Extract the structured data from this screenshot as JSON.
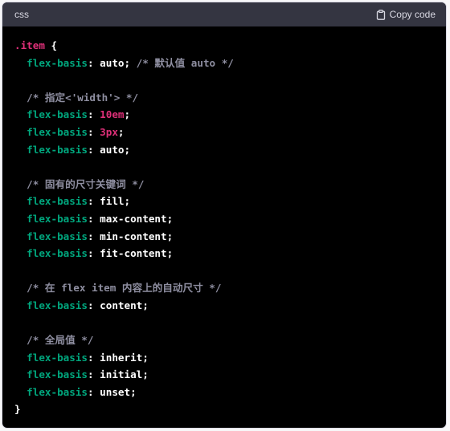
{
  "header": {
    "language": "css",
    "copy_label": "Copy code",
    "copy_icon": "clipboard-icon"
  },
  "code": {
    "lines": [
      [
        {
          "t": ".item",
          "c": "sel"
        },
        {
          "t": " {",
          "c": "punc"
        }
      ],
      [
        {
          "t": "  ",
          "c": "punc"
        },
        {
          "t": "flex-basis",
          "c": "prop"
        },
        {
          "t": ": auto; ",
          "c": "punc"
        },
        {
          "t": "/* 默认值 auto */",
          "c": "cmt"
        }
      ],
      [],
      [
        {
          "t": "  ",
          "c": "punc"
        },
        {
          "t": "/* 指定<'width'> */",
          "c": "cmt"
        }
      ],
      [
        {
          "t": "  ",
          "c": "punc"
        },
        {
          "t": "flex-basis",
          "c": "prop"
        },
        {
          "t": ": ",
          "c": "punc"
        },
        {
          "t": "10em",
          "c": "num"
        },
        {
          "t": ";",
          "c": "punc"
        }
      ],
      [
        {
          "t": "  ",
          "c": "punc"
        },
        {
          "t": "flex-basis",
          "c": "prop"
        },
        {
          "t": ": ",
          "c": "punc"
        },
        {
          "t": "3px",
          "c": "num"
        },
        {
          "t": ";",
          "c": "punc"
        }
      ],
      [
        {
          "t": "  ",
          "c": "punc"
        },
        {
          "t": "flex-basis",
          "c": "prop"
        },
        {
          "t": ": auto;",
          "c": "punc"
        }
      ],
      [],
      [
        {
          "t": "  ",
          "c": "punc"
        },
        {
          "t": "/* 固有的尺寸关键词 */",
          "c": "cmt"
        }
      ],
      [
        {
          "t": "  ",
          "c": "punc"
        },
        {
          "t": "flex-basis",
          "c": "prop"
        },
        {
          "t": ": fill;",
          "c": "punc"
        }
      ],
      [
        {
          "t": "  ",
          "c": "punc"
        },
        {
          "t": "flex-basis",
          "c": "prop"
        },
        {
          "t": ": max-content;",
          "c": "punc"
        }
      ],
      [
        {
          "t": "  ",
          "c": "punc"
        },
        {
          "t": "flex-basis",
          "c": "prop"
        },
        {
          "t": ": min-content;",
          "c": "punc"
        }
      ],
      [
        {
          "t": "  ",
          "c": "punc"
        },
        {
          "t": "flex-basis",
          "c": "prop"
        },
        {
          "t": ": fit-content;",
          "c": "punc"
        }
      ],
      [],
      [
        {
          "t": "  ",
          "c": "punc"
        },
        {
          "t": "/* 在 flex item 内容上的自动尺寸 */",
          "c": "cmt"
        }
      ],
      [
        {
          "t": "  ",
          "c": "punc"
        },
        {
          "t": "flex-basis",
          "c": "prop"
        },
        {
          "t": ": content;",
          "c": "punc"
        }
      ],
      [],
      [
        {
          "t": "  ",
          "c": "punc"
        },
        {
          "t": "/* 全局值 */",
          "c": "cmt"
        }
      ],
      [
        {
          "t": "  ",
          "c": "punc"
        },
        {
          "t": "flex-basis",
          "c": "prop"
        },
        {
          "t": ": inherit;",
          "c": "punc"
        }
      ],
      [
        {
          "t": "  ",
          "c": "punc"
        },
        {
          "t": "flex-basis",
          "c": "prop"
        },
        {
          "t": ": initial;",
          "c": "punc"
        }
      ],
      [
        {
          "t": "  ",
          "c": "punc"
        },
        {
          "t": "flex-basis",
          "c": "prop"
        },
        {
          "t": ": unset;",
          "c": "punc"
        }
      ],
      [
        {
          "t": "}",
          "c": "punc"
        }
      ]
    ]
  },
  "colors": {
    "header_bg": "#343541",
    "code_bg": "#000000",
    "selector": "#df3079",
    "property": "#00a67d",
    "number": "#df3079",
    "comment": "#8e8ea0",
    "text": "#ffffff"
  }
}
